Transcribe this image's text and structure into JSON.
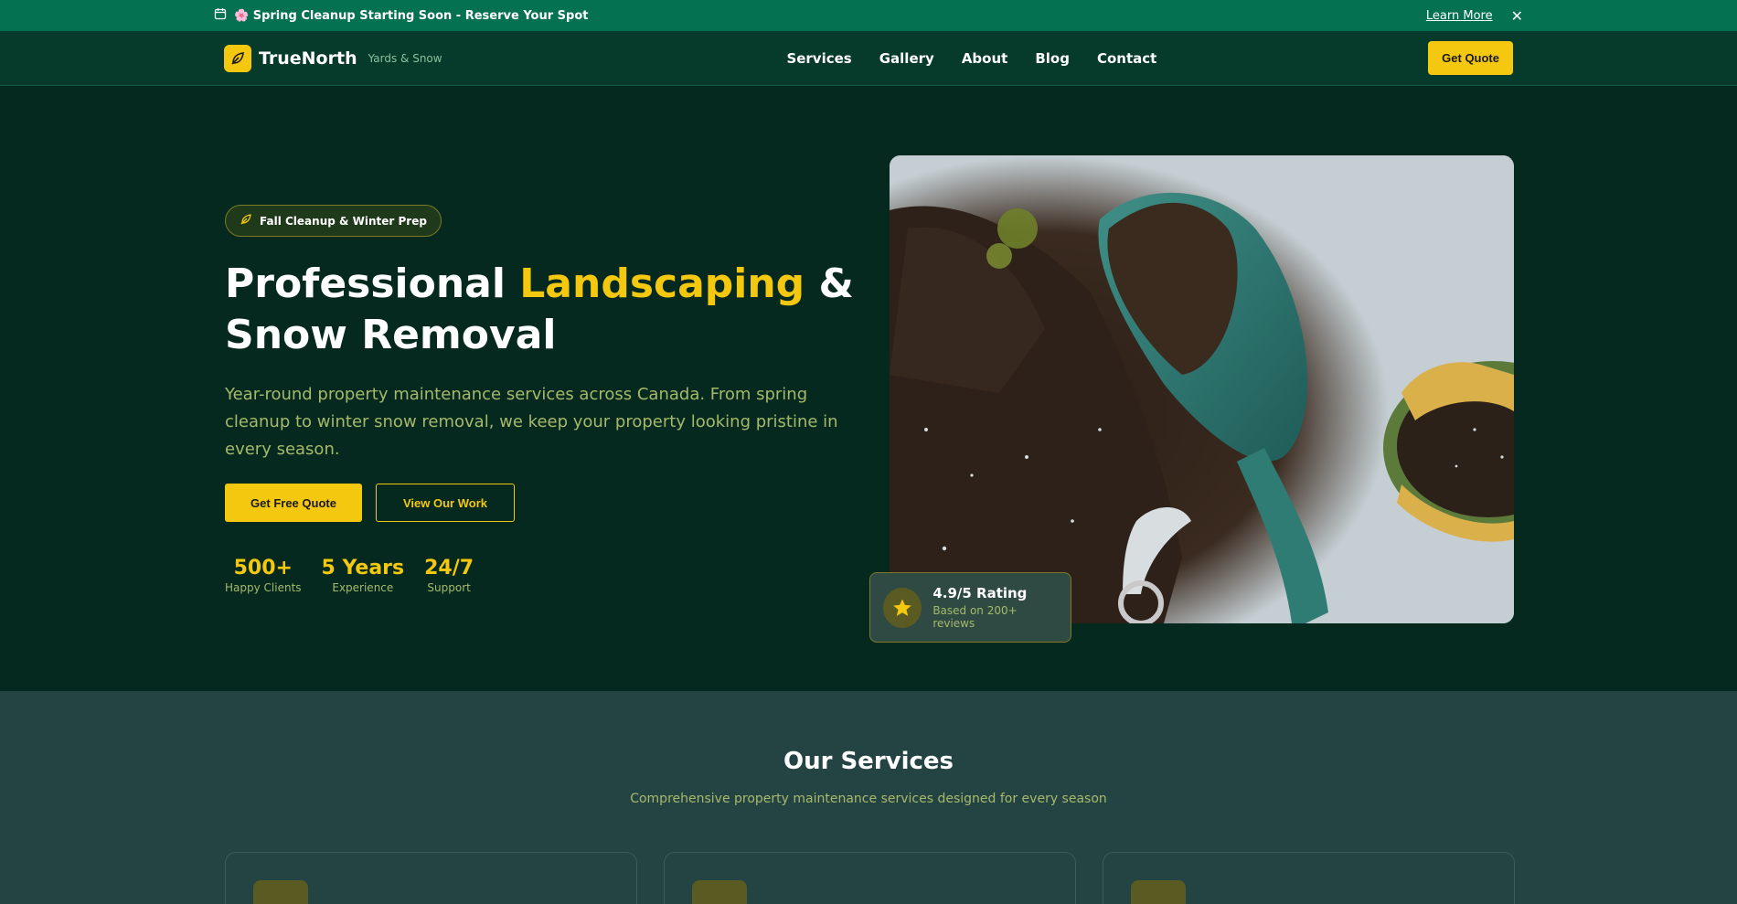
{
  "announcement": {
    "text": "🌸 Spring Cleanup Starting Soon - Reserve Your Spot",
    "link": "Learn More",
    "close": "✕"
  },
  "nav": {
    "brand": "TrueNorth",
    "tagline": "Yards & Snow",
    "items": [
      "Services",
      "Gallery",
      "About",
      "Blog",
      "Contact"
    ],
    "cta": "Get Quote"
  },
  "hero": {
    "badge": "Fall Cleanup & Winter Prep",
    "headline_1": "Professional ",
    "headline_accent": "Landscaping",
    "headline_2": " &",
    "headline_3": "Snow Removal",
    "description": "Year-round property maintenance services across Canada. From spring cleanup to winter snow removal, we keep your property looking pristine in every season.",
    "primary_cta": "Get Free Quote",
    "secondary_cta": "View Our Work",
    "stats": [
      {
        "value": "500+",
        "label": "Happy Clients"
      },
      {
        "value": "5 Years",
        "label": "Experience"
      },
      {
        "value": "24/7",
        "label": "Support"
      }
    ],
    "rating": {
      "title": "4.9/5 Rating",
      "subtitle": "Based on 200+ reviews"
    }
  },
  "services": {
    "title": "Our Services",
    "subtitle": "Comprehensive property maintenance services designed for every season"
  },
  "colors": {
    "accent": "#f4c80e",
    "announce_bg": "#047151",
    "hero_bg": "#05291e",
    "services_bg": "#244343"
  }
}
